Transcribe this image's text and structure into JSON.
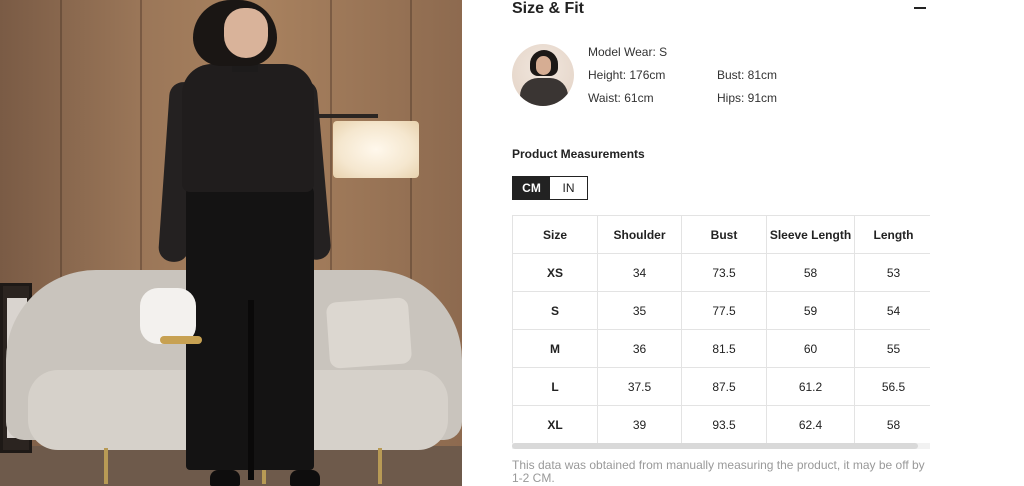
{
  "size_fit": {
    "title": "Size & Fit",
    "collapse_icon": "minus-icon"
  },
  "model": {
    "wear": "Model Wear: S",
    "height": "Height: 176cm",
    "bust": "Bust: 81cm",
    "waist": "Waist: 61cm",
    "hips": "Hips: 91cm"
  },
  "measurements": {
    "title": "Product Measurements",
    "units": [
      "CM",
      "IN"
    ],
    "selected_unit": "CM",
    "columns": [
      "Size",
      "Shoulder",
      "Bust",
      "Sleeve Length",
      "Length"
    ],
    "rows": [
      [
        "XS",
        "34",
        "73.5",
        "58",
        "53"
      ],
      [
        "S",
        "35",
        "77.5",
        "59",
        "54"
      ],
      [
        "M",
        "36",
        "81.5",
        "60",
        "55"
      ],
      [
        "L",
        "37.5",
        "87.5",
        "61.2",
        "56.5"
      ],
      [
        "XL",
        "39",
        "93.5",
        "62.4",
        "58"
      ]
    ],
    "disclaimer": "This data was obtained from manually measuring the product, it may be off by 1-2 CM."
  },
  "colors": {
    "text": "#222222",
    "muted": "#999999",
    "active_toggle_bg": "#222222",
    "table_border": "#e3e3e3"
  }
}
